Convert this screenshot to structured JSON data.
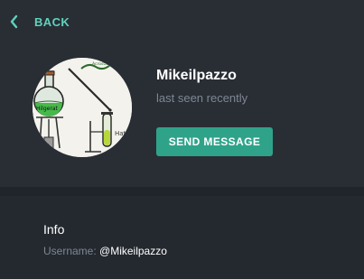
{
  "header": {
    "back_label": "BACK",
    "back_icon": "chevron-left-icon"
  },
  "profile": {
    "name": "Mikeilpazzo",
    "status": "last seen recently",
    "send_button_label": "SEND MESSAGE",
    "avatar_text": {
      "top_label": "Acrostate",
      "flask_label": "Hilgerat",
      "right_label": "Hat"
    }
  },
  "info": {
    "title": "Info",
    "username_label": "Username:",
    "username_value": "@Mikeilpazzo"
  },
  "colors": {
    "accent": "#5fd3bd",
    "button": "#2fa38a",
    "background": "#242930",
    "panel": "#292e35",
    "divider": "#20252b",
    "muted_text": "#7f8791"
  }
}
